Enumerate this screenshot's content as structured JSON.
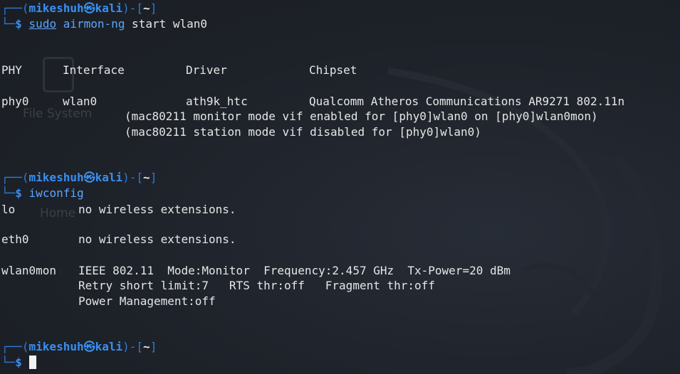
{
  "desktop": {
    "icons": [
      {
        "label": "File System",
        "icon": "drive-icon"
      },
      {
        "label": "Home",
        "icon": "home-folder-icon"
      }
    ]
  },
  "prompt": {
    "frame_top_left": "┌──(",
    "user": "mikeshuh",
    "at": "㉿",
    "host": "kali",
    "frame_mid": ")-[",
    "dir": "~",
    "frame_end": "]",
    "frame_bottom": "└─",
    "symbol": "$"
  },
  "commands": [
    {
      "program": "sudo",
      "rest_cmd": "airmon-ng",
      "args": " start wlan0"
    },
    {
      "program": "iwconfig"
    }
  ],
  "airmon": {
    "headers": [
      "PHY",
      "Interface",
      "Driver",
      "Chipset"
    ],
    "row": [
      "phy0",
      "wlan0",
      "ath9k_htc",
      "Qualcomm Atheros Communications AR9271 802.11n"
    ],
    "notes": [
      "(mac80211 monitor mode vif enabled for [phy0]wlan0 on [phy0]wlan0mon)",
      "(mac80211 station mode vif disabled for [phy0]wlan0)"
    ]
  },
  "iwconfig": {
    "lo": {
      "iface": "lo",
      "text": "no wireless extensions."
    },
    "eth0": {
      "iface": "eth0",
      "text": "no wireless extensions."
    },
    "wlan0mon": {
      "iface": "wlan0mon",
      "line1": "IEEE 802.11  Mode:Monitor  Frequency:2.457 GHz  Tx-Power=20 dBm",
      "line2": "Retry short limit:7   RTS thr:off   Fragment thr:off",
      "line3": "Power Management:off"
    }
  },
  "colors": {
    "background": "#1d2128",
    "prompt_blue": "#3a8ff0",
    "command_blue": "#5aa6ff",
    "text": "#e6e6e6"
  }
}
